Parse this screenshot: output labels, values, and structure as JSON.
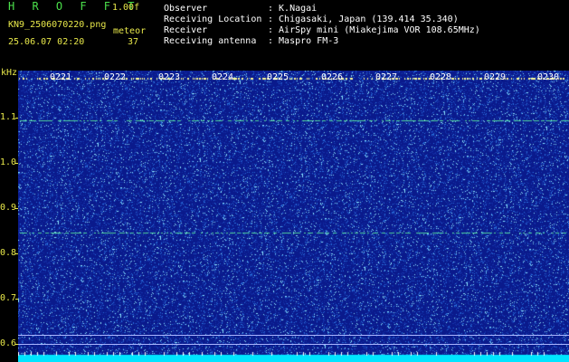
{
  "header": {
    "brand": "H R O F F T",
    "version": "1.00f",
    "filename": "KN9_2506070220.png",
    "mode": "meteor",
    "datetime": "25.06.07 02:20",
    "count": "37"
  },
  "info": [
    {
      "key": "Observer",
      "value": ": K.Nagai"
    },
    {
      "key": "Receiving Location",
      "value": ": Chigasaki, Japan (139.414 35.340)"
    },
    {
      "key": "Receiver",
      "value": ": AirSpy mini (Miakejima VOR 108.65MHz)"
    },
    {
      "key": "Receiving antenna",
      "value": ": Maspro FM-3"
    }
  ],
  "axis": {
    "unit": "kHz",
    "labels": [
      "1.1",
      "1.0",
      "0.9",
      "0.8",
      "0.7",
      "0.6"
    ]
  },
  "time_labels": [
    "0221",
    "0222",
    "0223",
    "0224",
    "0225",
    "0226",
    "0227",
    "0228",
    "0229",
    "0230"
  ],
  "colors": {
    "background": "#0a1a8c",
    "noise": "#3fd0ff",
    "signal_line": "#5fff9f",
    "bottom_band": "#00e5ff"
  }
}
